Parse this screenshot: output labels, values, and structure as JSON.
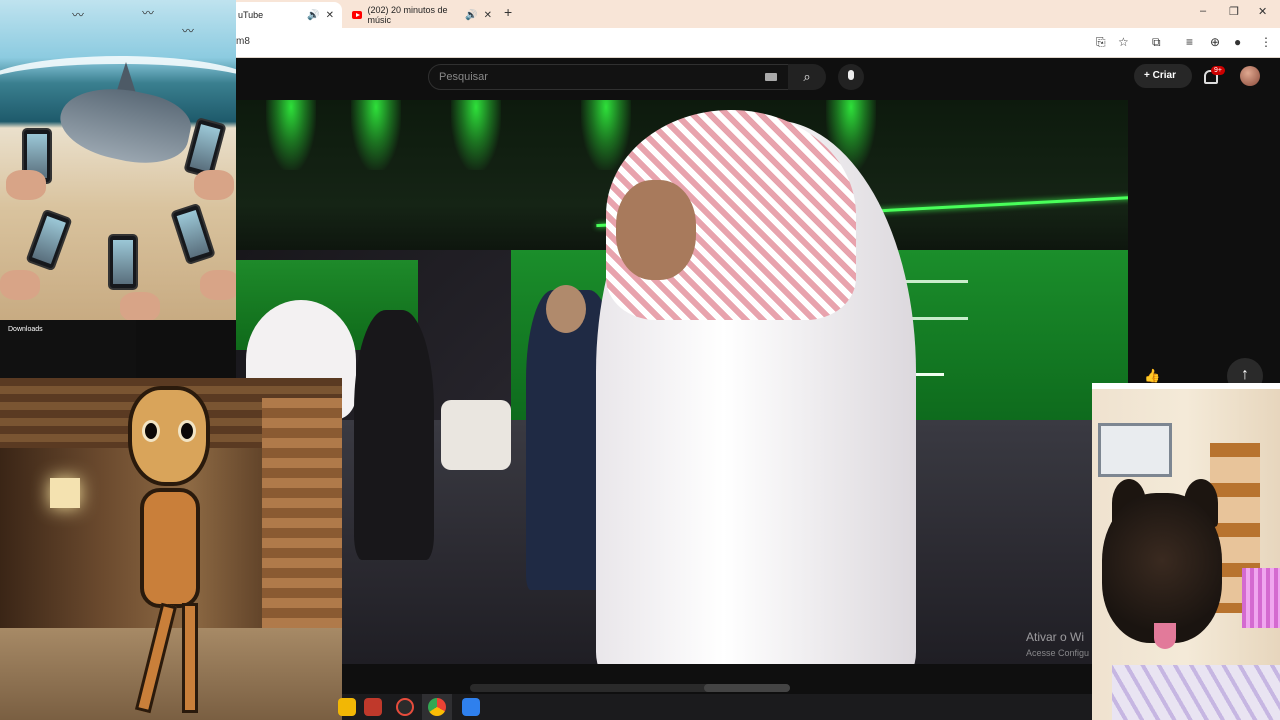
{
  "browser": {
    "tabs": [
      {
        "title": "uTube"
      },
      {
        "title": "(202) 20 minutos de músic"
      }
    ],
    "new_tab": "+",
    "url": "m8",
    "window_controls": [
      "–",
      "❐",
      "✕"
    ]
  },
  "youtube": {
    "search_placeholder": "Pesquisar",
    "create_label": "Criar",
    "notification_badge": "9+"
  },
  "video": {
    "watermark_line1": "Ativar o Wi",
    "watermark_line2": "Acesse Configu"
  },
  "overlays": {
    "downloads_label": "Downloads"
  },
  "colors": {
    "youtube_red": "#ff0000",
    "stage_green": "#1b8e2b",
    "chrome_tab_bar": "#f8e5d7"
  },
  "icons": {
    "tab_audio": "speaker-icon",
    "tab_close": "close-icon",
    "search": "search-icon",
    "mic": "mic-icon",
    "bell": "bell-icon",
    "scroll_top": "arrow-up-icon"
  }
}
